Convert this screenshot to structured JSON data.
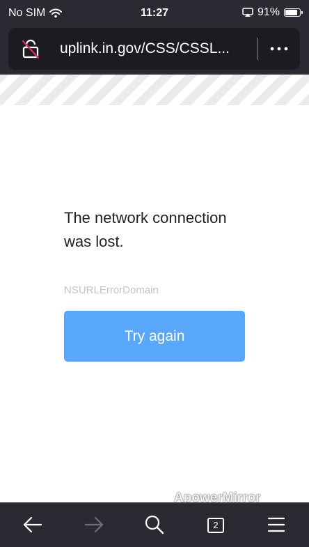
{
  "status_bar": {
    "carrier": "No SIM",
    "time": "11:27",
    "battery_percent_label": "91%",
    "battery_level": 0.91
  },
  "url_bar": {
    "url": "uplink.in.gov/CSS/CSSL..."
  },
  "error": {
    "message": "The network connection was lost.",
    "domain": "NSURLErrorDomain",
    "retry_label": "Try again"
  },
  "watermark": "ApowerMirror",
  "toolbar": {
    "tab_count": "2"
  },
  "icons": {
    "lock": "insecure-lock-icon",
    "more": "more-horizontal-icon",
    "back": "back-arrow-icon",
    "forward": "forward-arrow-icon",
    "search": "search-icon",
    "tabs": "tabs-icon",
    "menu": "hamburger-menu-icon"
  },
  "colors": {
    "chrome": "#2b2a33",
    "url_field": "#1c1b22",
    "primary_button": "#59a7fa",
    "insecure_slash": "#e22850"
  }
}
